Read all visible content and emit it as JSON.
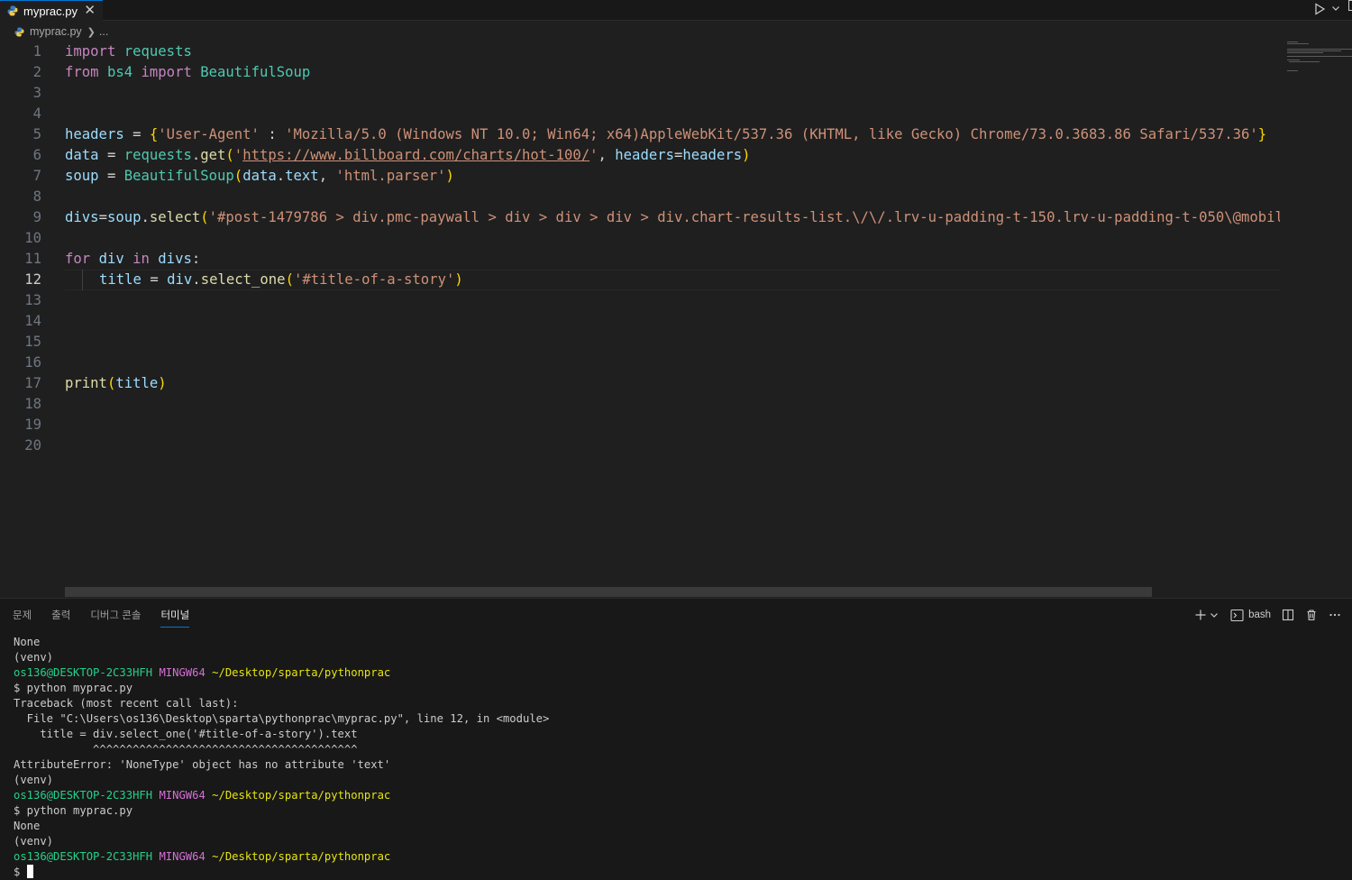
{
  "tab": {
    "filename": "myprac.py",
    "close": "✕"
  },
  "breadcrumb": {
    "file": "myprac.py",
    "more": "..."
  },
  "editor": {
    "active_line": 12,
    "line_numbers": [
      "1",
      "2",
      "3",
      "4",
      "5",
      "6",
      "7",
      "8",
      "9",
      "10",
      "11",
      "12",
      "13",
      "14",
      "15",
      "16",
      "17",
      "18",
      "19",
      "20"
    ],
    "l1": {
      "kw": "import",
      "mod": "requests"
    },
    "l2": {
      "kw1": "from",
      "mod": "bs4",
      "kw2": "import",
      "cls": "BeautifulSoup"
    },
    "l5": {
      "var": "headers",
      "op": " = ",
      "ob": "{",
      "key": "'User-Agent'",
      "colon": " : ",
      "val": "'Mozilla/5.0 (Windows NT 10.0; Win64; x64)AppleWebKit/537.36 (KHTML, like Gecko) Chrome/73.0.3683.86 Safari/537.36'",
      "cb": "}"
    },
    "l6": {
      "var": "data",
      "op": " = ",
      "mod": "requests",
      "dot": ".",
      "fn": "get",
      "op_paren": "(",
      "q1": "'",
      "url": "https://www.billboard.com/charts/hot-100/",
      "q2": "'",
      "comma": ", ",
      "kwarg": "headers",
      "eq": "=",
      "val": "headers",
      "cl_paren": ")"
    },
    "l7": {
      "var": "soup",
      "op": " = ",
      "cls": "BeautifulSoup",
      "op_paren": "(",
      "arg1": "data",
      "dot": ".",
      "arg1b": "text",
      "comma": ", ",
      "str": "'html.parser'",
      "cl_paren": ")"
    },
    "l9": {
      "var": "divs",
      "eq": "=",
      "obj": "soup",
      "dot": ".",
      "fn": "select",
      "op_paren": "(",
      "str": "'#post-1479786 > div.pmc-paywall > div > div > div > div.chart-results-list.\\/\\/.lrv-u-padding-t-150.lrv-u-padding-t-050\\@mobil"
    },
    "l11": {
      "kw": "for",
      "v1": "div",
      "kw2": "in",
      "v2": "divs",
      "colon": ":"
    },
    "l12": {
      "var": "title",
      "op": " = ",
      "obj": "div",
      "dot": ".",
      "fn": "select_one",
      "op_paren": "(",
      "str": "'#title-of-a-story'",
      "cl_paren": ")"
    },
    "l17": {
      "fn": "print",
      "op_paren": "(",
      "arg": "title",
      "cl_paren": ")"
    }
  },
  "panel": {
    "tabs": [
      "문제",
      "출력",
      "디버그 콘솔",
      "터미널"
    ],
    "active_tab": "터미널",
    "shell": "bash"
  },
  "terminal": {
    "l1": "None",
    "l2": "(venv)",
    "p1_user": "os136@DESKTOP-2C33HFH",
    "p1_sys": "MINGW64",
    "p1_path": "~/Desktop/sparta/pythonprac",
    "l4": "$ python myprac.py",
    "l5": "Traceback (most recent call last):",
    "l6": "  File \"C:\\Users\\os136\\Desktop\\sparta\\pythonprac\\myprac.py\", line 12, in <module>",
    "l7": "    title = div.select_one('#title-of-a-story').text",
    "l8": "            ^^^^^^^^^^^^^^^^^^^^^^^^^^^^^^^^^^^^^^^^",
    "l9": "AttributeError: 'NoneType' object has no attribute 'text'",
    "l10": "(venv)",
    "p2_user": "os136@DESKTOP-2C33HFH",
    "p2_sys": "MINGW64",
    "p2_path": "~/Desktop/sparta/pythonprac",
    "l12": "$ python myprac.py",
    "l13": "None",
    "l14": "(venv)",
    "p3_user": "os136@DESKTOP-2C33HFH",
    "p3_sys": "MINGW64",
    "p3_path": "~/Desktop/sparta/pythonprac",
    "prompt": "$ "
  },
  "colors": {
    "accent": "#0078d4",
    "background": "#1f1f1f",
    "panel": "#181818"
  }
}
